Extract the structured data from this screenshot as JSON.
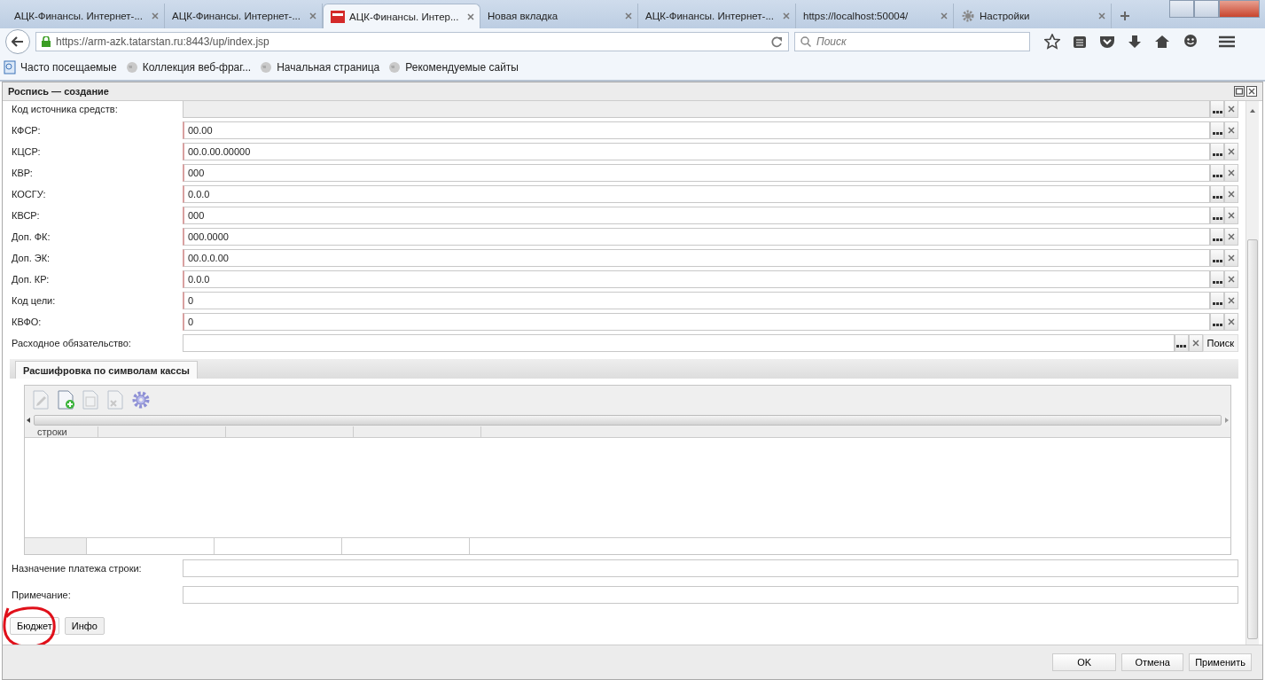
{
  "browser": {
    "tabs": [
      {
        "title": "АЦК-Финансы. Интернет-...",
        "selected": false,
        "kind": "plain"
      },
      {
        "title": "АЦК-Финансы. Интернет-...",
        "selected": false,
        "kind": "plain"
      },
      {
        "title": "АЦК-Финансы. Интер...",
        "selected": true,
        "kind": "logo"
      },
      {
        "title": "Новая вкладка",
        "selected": false,
        "kind": "plain"
      },
      {
        "title": "АЦК-Финансы. Интернет-...",
        "selected": false,
        "kind": "plain"
      },
      {
        "title": "https://localhost:50004/",
        "selected": false,
        "kind": "plain"
      },
      {
        "title": "Настройки",
        "selected": false,
        "kind": "gear"
      }
    ],
    "url": "https://arm-azk.tatarstan.ru:8443/up/index.jsp",
    "search": {
      "placeholder": "Поиск"
    },
    "bookmarks": [
      {
        "label": "Часто посещаемые",
        "kind": "page"
      },
      {
        "label": "Коллекция веб-фраг...",
        "kind": "globe"
      },
      {
        "label": "Начальная страница",
        "kind": "globe"
      },
      {
        "label": "Рекомендуемые сайты",
        "kind": "globe"
      }
    ]
  },
  "dialog": {
    "title": "Роспись — создание",
    "fields": [
      {
        "label": "Код источника средств:",
        "kind": "lookup",
        "required": false,
        "disabled": true
      },
      {
        "label": "КФСР:",
        "value": "00.00",
        "kind": "lookup",
        "required": true,
        "disabled": false
      },
      {
        "label": "КЦСР:",
        "value": "00.0.00.00000",
        "kind": "lookup",
        "required": true,
        "disabled": false
      },
      {
        "label": "КВР:",
        "value": "000",
        "kind": "lookup",
        "required": true,
        "disabled": false
      },
      {
        "label": "КОСГУ:",
        "value": "0.0.0",
        "kind": "lookup",
        "required": true,
        "disabled": false
      },
      {
        "label": "КВСР:",
        "value": "000",
        "kind": "lookup",
        "required": true,
        "disabled": false
      },
      {
        "label": "Доп. ФК:",
        "value": "000.0000",
        "kind": "lookup",
        "required": true,
        "disabled": false
      },
      {
        "label": "Доп. ЭК:",
        "value": "00.0.0.00",
        "kind": "lookup",
        "required": true,
        "disabled": false
      },
      {
        "label": "Доп. КР:",
        "value": "0.0.0",
        "kind": "lookup",
        "required": true,
        "disabled": false
      },
      {
        "label": "Код цели:",
        "value": "0",
        "kind": "lookup",
        "required": true,
        "disabled": false
      },
      {
        "label": "КВФО:",
        "value": "0",
        "kind": "lookup",
        "required": true,
        "disabled": false
      },
      {
        "label": "Расходное обязательство:",
        "kind": "search",
        "search_label": "Поиск",
        "required": false,
        "disabled": false
      }
    ],
    "section_tabs": [
      {
        "label": "Расшифровка по символам кассы",
        "selected": true
      }
    ],
    "grid": {
      "columns": [
        "строки"
      ]
    },
    "text_fields": [
      {
        "label": "Назначение платежа строки:"
      },
      {
        "label": "Примечание:"
      }
    ],
    "bottom_tabs": [
      {
        "label": "Бюджет",
        "selected": true,
        "circled": true
      },
      {
        "label": "Инфо",
        "selected": false,
        "circled": false
      }
    ],
    "buttons": [
      "OK",
      "Отмена",
      "Применить"
    ]
  }
}
